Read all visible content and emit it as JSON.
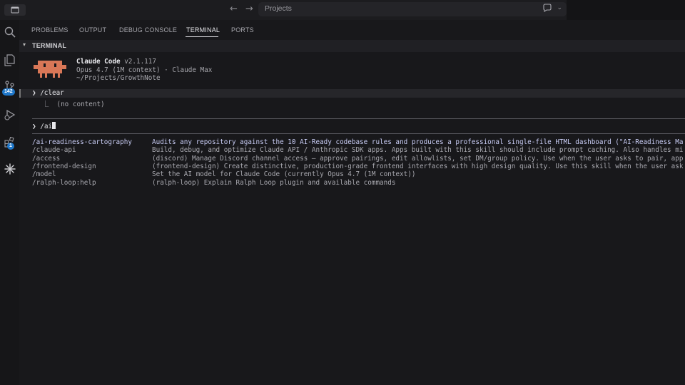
{
  "titlebar": {
    "nav_back": "←",
    "nav_forward": "→",
    "search_label": "Projects"
  },
  "activity_bar": {
    "source_control_badge": "142",
    "extensions_badge": "1"
  },
  "panel": {
    "tabs": [
      {
        "label": "PROBLEMS"
      },
      {
        "label": "OUTPUT"
      },
      {
        "label": "DEBUG CONSOLE"
      },
      {
        "label": "TERMINAL"
      },
      {
        "label": "PORTS"
      }
    ],
    "active_tab": "TERMINAL",
    "section_title": "TERMINAL"
  },
  "terminal": {
    "app_name": "Claude Code",
    "app_version": "v2.1.117",
    "model_line": "Opus 4.7 (1M context) · Claude Max",
    "cwd": "~/Projects/GrowthNote",
    "history_prompt": "❯ /clear",
    "history_output": "⎿  (no content)",
    "input_prompt": "❯",
    "input_value": "/ai",
    "suggestions": [
      {
        "command": "/ai-readiness-cartography",
        "description": "Audits any repository against the 10 AI-Ready codebase rules and produces a professional single-file HTML dashboard (\"AI-Readiness Ma"
      },
      {
        "command": "/claude-api",
        "description": "Build, debug, and optimize Claude API / Anthropic SDK apps. Apps built with this skill should include prompt caching. Also handles mi"
      },
      {
        "command": "/access",
        "description": "(discord) Manage Discord channel access — approve pairings, edit allowlists, set DM/group policy. Use when the user asks to pair, app"
      },
      {
        "command": "/frontend-design",
        "description": "(frontend-design) Create distinctive, production-grade frontend interfaces with high design quality. Use this skill when the user ask"
      },
      {
        "command": "/model",
        "description": "Set the AI model for Claude Code (currently Opus 4.7 (1M context))"
      },
      {
        "command": "/ralph-loop:help",
        "description": "(ralph-loop) Explain Ralph Loop plugin and available commands"
      }
    ]
  },
  "colors": {
    "mascot": "#d97757",
    "selected_suggestion": "#c9cdf5",
    "badge": "#1f77c9"
  }
}
